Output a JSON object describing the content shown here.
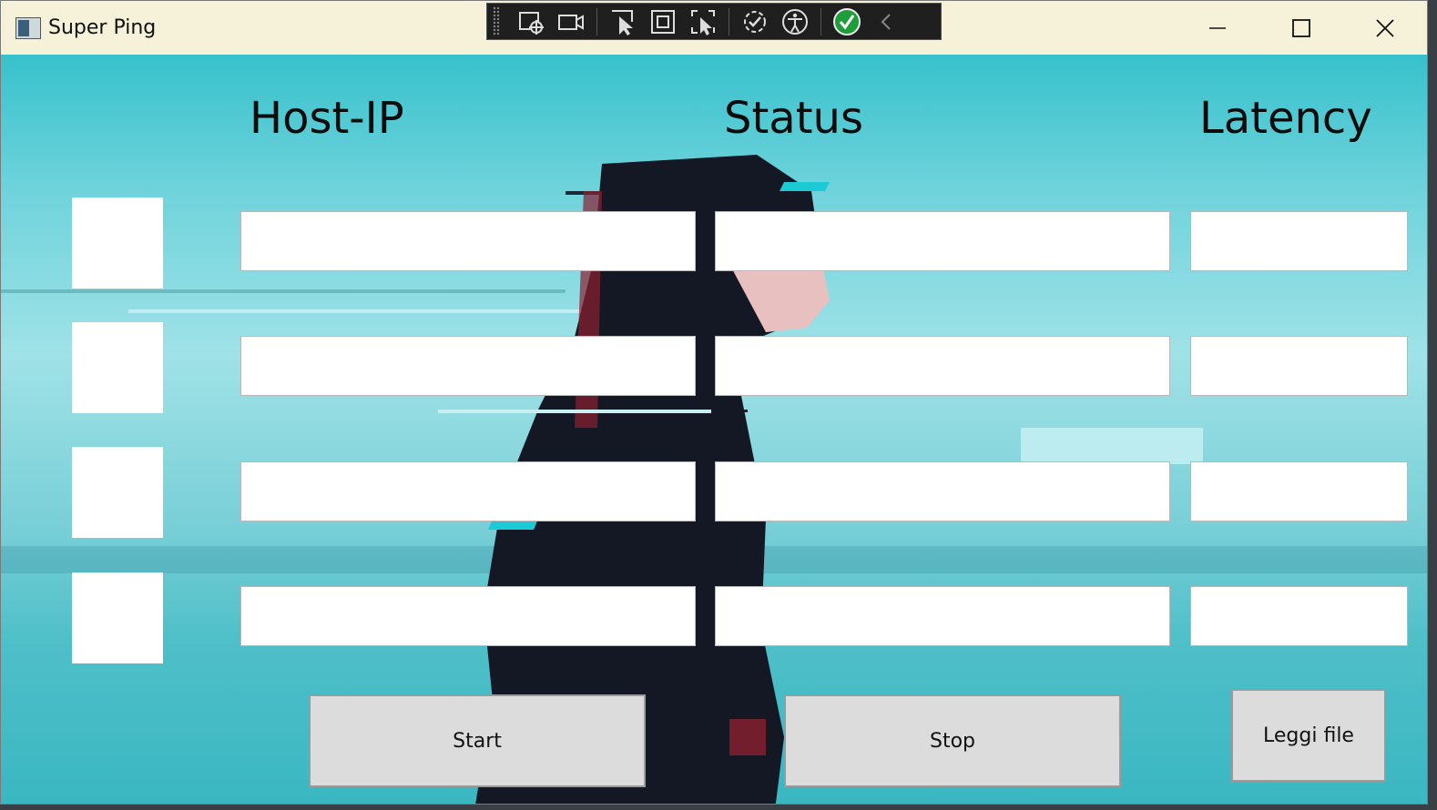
{
  "window": {
    "title": "Super Ping"
  },
  "devtools": {
    "tools": [
      "select-element-icon",
      "record-icon",
      "cursor-select-icon",
      "layout-bounds-icon",
      "track-focus-icon",
      "hot-reload-icon",
      "accessibility-icon",
      "binding-check-icon",
      "collapse-chevron-icon"
    ]
  },
  "headers": {
    "host": "Host-IP",
    "status": "Status",
    "latency": "Latency"
  },
  "rows": [
    {
      "host": "",
      "status": "",
      "latency": ""
    },
    {
      "host": "",
      "status": "",
      "latency": ""
    },
    {
      "host": "",
      "status": "",
      "latency": ""
    },
    {
      "host": "",
      "status": "",
      "latency": ""
    }
  ],
  "buttons": {
    "start": "Start",
    "stop": "Stop",
    "read_file": "Leggi file"
  },
  "colors": {
    "titlebar": "#f6f2da",
    "accent_bg": "#6fd3db",
    "button": "#dcdcdc",
    "devtools_bg": "#1f1f1f",
    "check_green": "#1e9e3a"
  }
}
